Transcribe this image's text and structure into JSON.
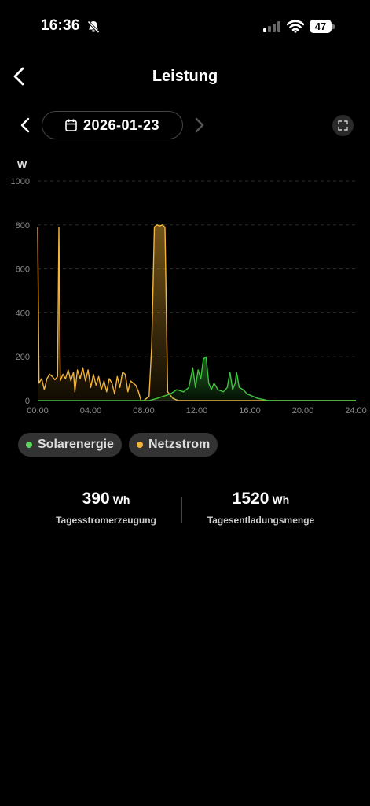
{
  "status_bar": {
    "time": "16:36",
    "battery": "47",
    "icons": [
      "bell-slash-icon",
      "cellular-signal-icon",
      "wifi-icon",
      "battery-icon"
    ]
  },
  "header": {
    "title": "Leistung",
    "back_icon": "chevron-left-icon"
  },
  "date_nav": {
    "date": "2026-01-23",
    "prev_icon": "chevron-left-icon",
    "next_icon": "chevron-right-icon",
    "calendar_icon": "calendar-icon",
    "expand_icon": "expand-icon"
  },
  "chart_data": {
    "type": "area",
    "ylabel": "W",
    "ylim": [
      0,
      1000
    ],
    "yticks": [
      "0",
      "200",
      "400",
      "600",
      "800",
      "1000"
    ],
    "xticks": [
      "00:00",
      "04:00",
      "08:00",
      "12:00",
      "16:00",
      "20:00",
      "24:00"
    ],
    "xlim_hours": [
      0,
      24
    ],
    "grid": "dashed horizontal",
    "series": [
      {
        "name": "Netzstrom",
        "color": "#f2b43c",
        "points": [
          [
            0.0,
            790
          ],
          [
            0.1,
            80
          ],
          [
            0.3,
            100
          ],
          [
            0.5,
            50
          ],
          [
            0.7,
            100
          ],
          [
            0.9,
            120
          ],
          [
            1.1,
            110
          ],
          [
            1.3,
            95
          ],
          [
            1.5,
            110
          ],
          [
            1.6,
            790
          ],
          [
            1.7,
            90
          ],
          [
            1.9,
            120
          ],
          [
            2.1,
            100
          ],
          [
            2.3,
            140
          ],
          [
            2.5,
            90
          ],
          [
            2.7,
            130
          ],
          [
            2.8,
            40
          ],
          [
            3.0,
            140
          ],
          [
            3.2,
            100
          ],
          [
            3.4,
            150
          ],
          [
            3.6,
            90
          ],
          [
            3.8,
            140
          ],
          [
            4.0,
            60
          ],
          [
            4.2,
            120
          ],
          [
            4.4,
            70
          ],
          [
            4.6,
            110
          ],
          [
            4.8,
            50
          ],
          [
            5.0,
            90
          ],
          [
            5.2,
            40
          ],
          [
            5.4,
            100
          ],
          [
            5.6,
            80
          ],
          [
            5.8,
            30
          ],
          [
            6.0,
            110
          ],
          [
            6.2,
            60
          ],
          [
            6.4,
            130
          ],
          [
            6.6,
            120
          ],
          [
            6.8,
            40
          ],
          [
            7.0,
            90
          ],
          [
            7.2,
            80
          ],
          [
            7.4,
            70
          ],
          [
            7.6,
            40
          ],
          [
            7.8,
            0
          ],
          [
            8.0,
            0
          ],
          [
            8.4,
            20
          ],
          [
            8.6,
            250
          ],
          [
            8.8,
            790
          ],
          [
            9.0,
            800
          ],
          [
            9.2,
            795
          ],
          [
            9.4,
            800
          ],
          [
            9.6,
            790
          ],
          [
            9.8,
            40
          ],
          [
            10.2,
            10
          ],
          [
            10.6,
            0
          ],
          [
            11.0,
            0
          ],
          [
            12.0,
            0
          ],
          [
            16.0,
            0
          ],
          [
            24.0,
            0
          ]
        ]
      },
      {
        "name": "Solarenergie",
        "color": "#3fc53f",
        "points": [
          [
            0.0,
            0
          ],
          [
            8.4,
            0
          ],
          [
            9.0,
            10
          ],
          [
            9.5,
            20
          ],
          [
            10.0,
            30
          ],
          [
            10.5,
            50
          ],
          [
            11.0,
            40
          ],
          [
            11.4,
            60
          ],
          [
            11.7,
            150
          ],
          [
            11.9,
            60
          ],
          [
            12.1,
            140
          ],
          [
            12.3,
            100
          ],
          [
            12.5,
            190
          ],
          [
            12.7,
            200
          ],
          [
            12.9,
            80
          ],
          [
            13.1,
            50
          ],
          [
            13.3,
            80
          ],
          [
            13.6,
            50
          ],
          [
            14.0,
            40
          ],
          [
            14.3,
            60
          ],
          [
            14.5,
            130
          ],
          [
            14.7,
            50
          ],
          [
            14.9,
            80
          ],
          [
            15.0,
            130
          ],
          [
            15.2,
            60
          ],
          [
            15.5,
            50
          ],
          [
            15.8,
            30
          ],
          [
            16.2,
            20
          ],
          [
            16.6,
            10
          ],
          [
            17.0,
            5
          ],
          [
            17.4,
            0
          ],
          [
            24.0,
            0
          ]
        ]
      }
    ]
  },
  "legend": [
    {
      "label": "Solarenergie",
      "color": "#5fd35f"
    },
    {
      "label": "Netzstrom",
      "color": "#f2b43c"
    }
  ],
  "stats": [
    {
      "value": "390",
      "unit": "Wh",
      "caption": "Tagesstromerzeugung"
    },
    {
      "value": "1520",
      "unit": "Wh",
      "caption": "Tagesentladungsmenge"
    }
  ]
}
